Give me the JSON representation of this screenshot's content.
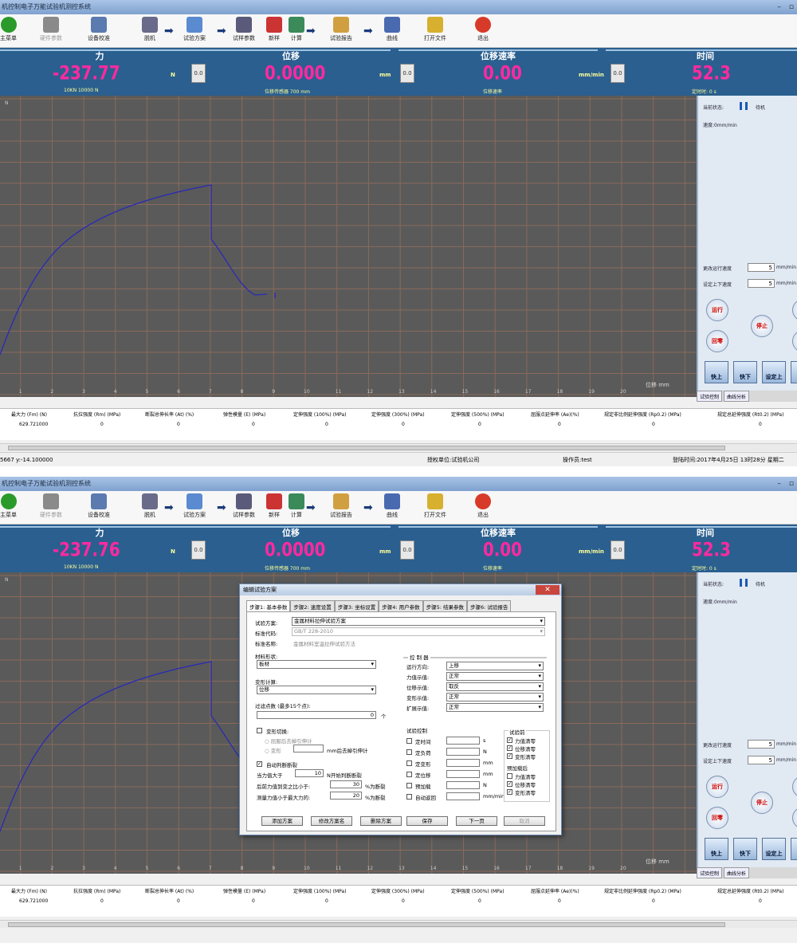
{
  "window": {
    "title": "机控制电子万能试验机测控系统",
    "controls": [
      "–",
      "▫"
    ]
  },
  "toolbar": {
    "items": [
      {
        "label": "主菜单",
        "icon": "main-menu-icon"
      },
      {
        "label": "硬件参数",
        "icon": "gear-icon",
        "disabled": true
      },
      {
        "label": "设备校准",
        "icon": "calibrate-icon"
      },
      {
        "label": "脱机",
        "icon": "clip-icon"
      },
      {
        "label": "试验方案",
        "icon": "plan-icon"
      },
      {
        "label": "试样参数",
        "icon": "specimen-icon"
      },
      {
        "label": "新样",
        "icon": "new-sample-icon"
      },
      {
        "label": "计算",
        "icon": "calculator-icon"
      },
      {
        "label": "试验报告",
        "icon": "report-icon"
      },
      {
        "label": "曲线",
        "icon": "curve-icon"
      },
      {
        "label": "打开文件",
        "icon": "folder-icon"
      },
      {
        "label": "退出",
        "icon": "exit-icon"
      }
    ]
  },
  "readouts": {
    "force": {
      "title": "力",
      "unit": "N",
      "sub": "10KN 10000 N",
      "zero": "0.0"
    },
    "disp": {
      "title": "位移",
      "value": "0.0000",
      "unit": "mm",
      "sub": "位移传感器 700 mm",
      "zero": "0.0"
    },
    "speed": {
      "title": "位移速率",
      "value": "0.00",
      "unit": "mm/min",
      "sub": "位移速率",
      "zero": "0.0"
    },
    "time": {
      "title": "时间",
      "value": "52.3",
      "sub": "定时时: 0 s"
    }
  },
  "force_values": [
    "-237.77",
    "-237.76"
  ],
  "plot": {
    "y_unit": "N",
    "x_label": "位移 mm",
    "x_ticks": [
      "1",
      "2",
      "3",
      "4",
      "5",
      "6",
      "7",
      "8",
      "9",
      "10",
      "11",
      "12",
      "13",
      "14",
      "15",
      "16",
      "17",
      "18",
      "19",
      "20"
    ]
  },
  "side": {
    "status_label": "当前状态:",
    "status_value": "待机",
    "speed_label": "速度:0mm/min",
    "run_speed_label": "更改运行速度",
    "run_speed_value": "5",
    "set_speed_label": "设定上下速度",
    "set_speed_value": "5",
    "unit": "mm/min",
    "run": "运行",
    "stop": "停止",
    "return": "回零",
    "fast_up": "快上",
    "fast_down": "快下",
    "set_up": "设定上",
    "tab_control": "试验控制",
    "tab_analysis": "曲线分析"
  },
  "results": {
    "headers": [
      "最大力 (Fm) (N)",
      "抗拉强度 (Rm) (MPa)",
      "断裂总伸长率 (At) (%)",
      "弹性模量 (E) (MPa)",
      "定伸强度 (100%) (MPa)",
      "定伸强度 (300%) (MPa)",
      "定伸强度 (500%) (MPa)",
      "屈服点延伸率 (Ae)(%)",
      "规定非比例延伸强度 (Rp0.2) (MPa)",
      "规定总延伸强度 (Rt0.2) (MPa)"
    ],
    "values": [
      "629.721000",
      "0",
      "0",
      "0",
      "0",
      "0",
      "0",
      "0",
      "0",
      "0"
    ]
  },
  "status": {
    "coords": "5667 y:-14.100000",
    "company": "授权单位:试验机公司",
    "operator": "操作员:test",
    "login": "登陆时间:2017年4月25日 13时28分 星期二"
  },
  "dialog": {
    "title": "编辑试验方案",
    "tabs": [
      "步骤1: 基本参数",
      "步骤2: 速度设置",
      "步骤3: 坐标设置",
      "步骤4: 用户参数",
      "步骤5: 结果参数",
      "步骤6: 试验报告"
    ],
    "plan_label": "试验方案:",
    "plan_value": "金属材料拉伸试验方案",
    "std_code_label": "标准代码:",
    "std_code_value": "GB/T 228-2010",
    "std_name_label": "标准名称:",
    "std_name_value": "金属材料室温拉伸试验方法",
    "shape_label": "材料形状:",
    "shape_value": "板材",
    "deform_label": "变形计算:",
    "deform_value": "位移",
    "filter_label": "过滤点数 (最多15个点):",
    "filter_value": "0",
    "filter_unit": "个",
    "deform_switch": "变形切换:",
    "after_yield": "屈服后去掉引伸计",
    "deform_opt": "变形",
    "deform_opt_suffix": "mm后去掉引伸计",
    "auto_break": "自动判断断裂",
    "force_gt": "当力值大于",
    "force_gt_value": "10",
    "force_gt_suffix": "N开始判断断裂",
    "ratio_label": "后前力值到变之比小于:",
    "ratio_value": "30",
    "ratio_suffix": "%为断裂",
    "max_label": "测量力值小于最大力的:",
    "max_value": "20",
    "max_suffix": "%为断裂",
    "ctrl_title": "控 制 器",
    "ctrl": [
      {
        "label": "运行方向:",
        "value": "上移"
      },
      {
        "label": "力值示值:",
        "value": "正常"
      },
      {
        "label": "位移示值:",
        "value": "取反"
      },
      {
        "label": "变形示值:",
        "value": "正常"
      },
      {
        "label": "扩展示值:",
        "value": "正常"
      }
    ],
    "test_ctrl_title": "试验控制",
    "test_ctrl": [
      {
        "label": "定时间",
        "unit": "s"
      },
      {
        "label": "定负荷",
        "unit": "N"
      },
      {
        "label": "定变形",
        "unit": "mm"
      },
      {
        "label": "定位移",
        "unit": "mm"
      },
      {
        "label": "预加载",
        "unit": "N"
      },
      {
        "label": "自动返回",
        "unit": "mm/min"
      }
    ],
    "before_title": "试验前",
    "before": [
      "力值清零",
      "位移清零",
      "变形清零"
    ],
    "preload_title": "预加载后",
    "preload": [
      "力值清零",
      "位移清零",
      "变形清零"
    ],
    "preload_checked": [
      false,
      true,
      true
    ],
    "buttons": {
      "add": "添加方案",
      "rename": "修改方案名",
      "delete": "删除方案",
      "save": "保存",
      "next": "下一页",
      "cancel": "取消"
    }
  },
  "colors": {
    "readout_bg": "#2a5f8f",
    "value": "#ff2aa0",
    "plot_bg": "#5a5a5a",
    "grid": "#8a6a5a",
    "curve": "#2a2ab5"
  }
}
